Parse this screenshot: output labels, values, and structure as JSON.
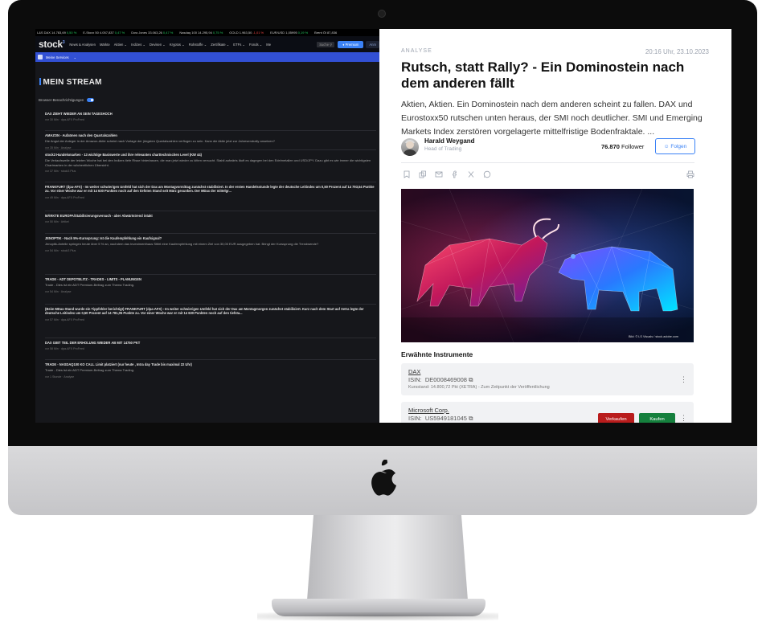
{
  "ticker": [
    {
      "label": "L&S DAX 14.783,69",
      "change": "0,50 %",
      "dir": "up"
    },
    {
      "label": "E-Stoxx 50 4.057,837",
      "change": "0,47 %",
      "dir": "up"
    },
    {
      "label": "Dow Jones 33.063,26",
      "change": "0,47 %",
      "dir": "up"
    },
    {
      "label": "Nasdaq 100 14.295,94",
      "change": "0,75 %",
      "dir": "up"
    },
    {
      "label": "GOLD 1.963,50",
      "change": "-1,01 %",
      "dir": "dn"
    },
    {
      "label": "EUR/USD 1,05995",
      "change": "0,19 %",
      "dir": "up"
    },
    {
      "label": "Brent Öl 87,836",
      "change": "",
      "dir": "up"
    }
  ],
  "left": {
    "logo": "stock",
    "logo_sup": "3",
    "nav": [
      "News & Analysen",
      "Märkte",
      "Aktien ⌄",
      "Indizes ⌄",
      "Devisen ⌄",
      "Kryptos ⌄",
      "Rohstoffe ⌄",
      "Zertifikate ⌄",
      "ETFs ⌄",
      "Fonds ⌄",
      "Me"
    ],
    "search_placeholder": "Suche",
    "premium_label": "Premium",
    "login_label": "Anm",
    "services_label": "Meine Services",
    "services_chevron": "⌄",
    "stream_title": "MEIN STREAM",
    "notif_label": "Browser-Benachrichtigungen",
    "items": [
      {
        "h": "DAX ZIEHT WIEDER AN SEIN TAGESHOCH",
        "b": "",
        "m": "vor 30 Min · dpa-AFX ProFeed"
      },
      {
        "h": "AMAZON - Aufatmen nach den Quartalszahlen",
        "b": "Die Angst der Anleger in der Amazon-Aktie scheint nach Vorlage der jüngsten Quartalszahlen verflogen zu sein. Kann die Aktie jetzt zur Jahresendrally ansetzen?",
        "m": "vor 35 Min · Analyse"
      },
      {
        "h": "stock3 Handelsmarken - 13 wichtige Basiswerte und ihre relevanten charttechnischen Level (KW 44)",
        "b": "Die Verlaufswelle der letzten Woche hat bei den Indizes tiefe Risse hinterlassen, die man jetzt wieder zu kitten versucht. Stabil aufwärts läuft es dagegen bei den Edelmetallen und USD/JPY. Dazu gibt es wie immer die wichtigsten Chartmarken in der wöchentlichen Übersicht.",
        "m": "vor 37 Min · stock3 Plus"
      },
      {
        "h": "FRANKFURT (dpa-AFX) - Im weiter schwierigen Umfeld hat sich der Dax am Montagvormittag zunächst stabilisiert. In der ersten Handelsstunde legte der deutsche Leitindex um 0,50 Prozent auf 14 793,54 Punkte zu. Vor einer Woche war er mit 14 630 Punkten noch auf den tiefsten Stand seit März gesunken. Der MDax der mittelgr...",
        "b": "",
        "m": "vor 49 Min · dpa-AFX ProFeed"
      },
      {
        "h": "MÄRKTE EUROPA/Stabilisierungsversuch - aber Abwärtstrend intakt",
        "b": "",
        "m": "vor 50 Min · Artikel"
      },
      {
        "h": "JENOPTIK - Nach 5%-Kurssprung: Ist die Kaufempfehlung ein Kaufsignal?",
        "b": "Jenoptik-Anteile springen heute über 5 % an, nachdem das Investmenthaus Stifel eine Kaufempfehlung mit einem Ziel von 30,00 EUR ausgegeben hat. Bringt der Kurssprung die Trendwende?",
        "m": "vor 54 Min · stock3 Plus"
      },
      {
        "h": "TRADE - ADT DEPOTBLITZ - TRADES - LIMITS - PLANUNGEN",
        "b": "Trade - Dies ist ein ADT Premium-Beitrag zum Thema Trading.",
        "m": "vor 54 Min · Analyse"
      },
      {
        "h": "(Beim MDax-Stand wurde ein Tippfehler berichtigt) FRANKFURT (dpa-AFX) - Im weiter schwierigen Umfeld hat sich der Dax am Montagmorgen zunächst stabilisiert. Kurz nach dem Start auf Xetra legte der deutsche Leitindex um 0,50 Prozent auf 14 781,05 Punkte zu. Vor einer Woche war er mit 14 630 Punkten noch auf den tiefsta...",
        "b": "",
        "m": "vor 57 Min · dpa-AFX ProFeed"
      },
      {
        "h": "DAX GIBT TEIL DER ERHOLUNG WIEDER AB MIT 14750 PKT",
        "b": "",
        "m": "vor 58 Min · dpa-AFX ProFeed"
      },
      {
        "h": "TRADE - NASDAQ100 KO CALL Limit platziert (nur heute , Intra day Trade bis maximal 22 Uhr)",
        "b": "Trade - Dies ist ein ADT Premium-Beitrag zum Thema Trading.",
        "m": "vor 1 Stunde · Analyse"
      }
    ]
  },
  "article": {
    "kicker": "ANALYSE",
    "datetime": "20:16 Uhr, 23.10.2023",
    "headline": "Rutsch, statt Rally? - Ein Dominostein nach dem anderen fällt",
    "teaser": "Aktien, Aktien. Ein Dominostein nach dem anderen scheint zu fallen. DAX und Eurostoxx50 rutschen unten heraus, der SMI noch deutlicher. SMI und Emerging Markets Index zerstören vorgelagerte mittelfristige Bodenfraktale. ...",
    "author_name": "Harald Weygand",
    "author_role": "Head of Trading",
    "followers_count": "76.870",
    "followers_label": "Follower",
    "follow_label": "Folgen",
    "image_credit": "Bild: © LS Visuals / stock.adobe.com",
    "instruments_title": "Erwähnte Instrumente",
    "instruments": [
      {
        "name": "DAX",
        "isin_label": "ISIN:",
        "isin": "DE0008469008",
        "meta": "Kursstand: 14.800,72 Pkt (XETRA) - Zum Zeitpunkt der Veröffentlichung"
      },
      {
        "name": "Microsoft Corp.",
        "isin_label": "ISIN:",
        "isin": "US5949181045",
        "sell": "Verkaufen",
        "buy": "Kaufen"
      }
    ]
  }
}
